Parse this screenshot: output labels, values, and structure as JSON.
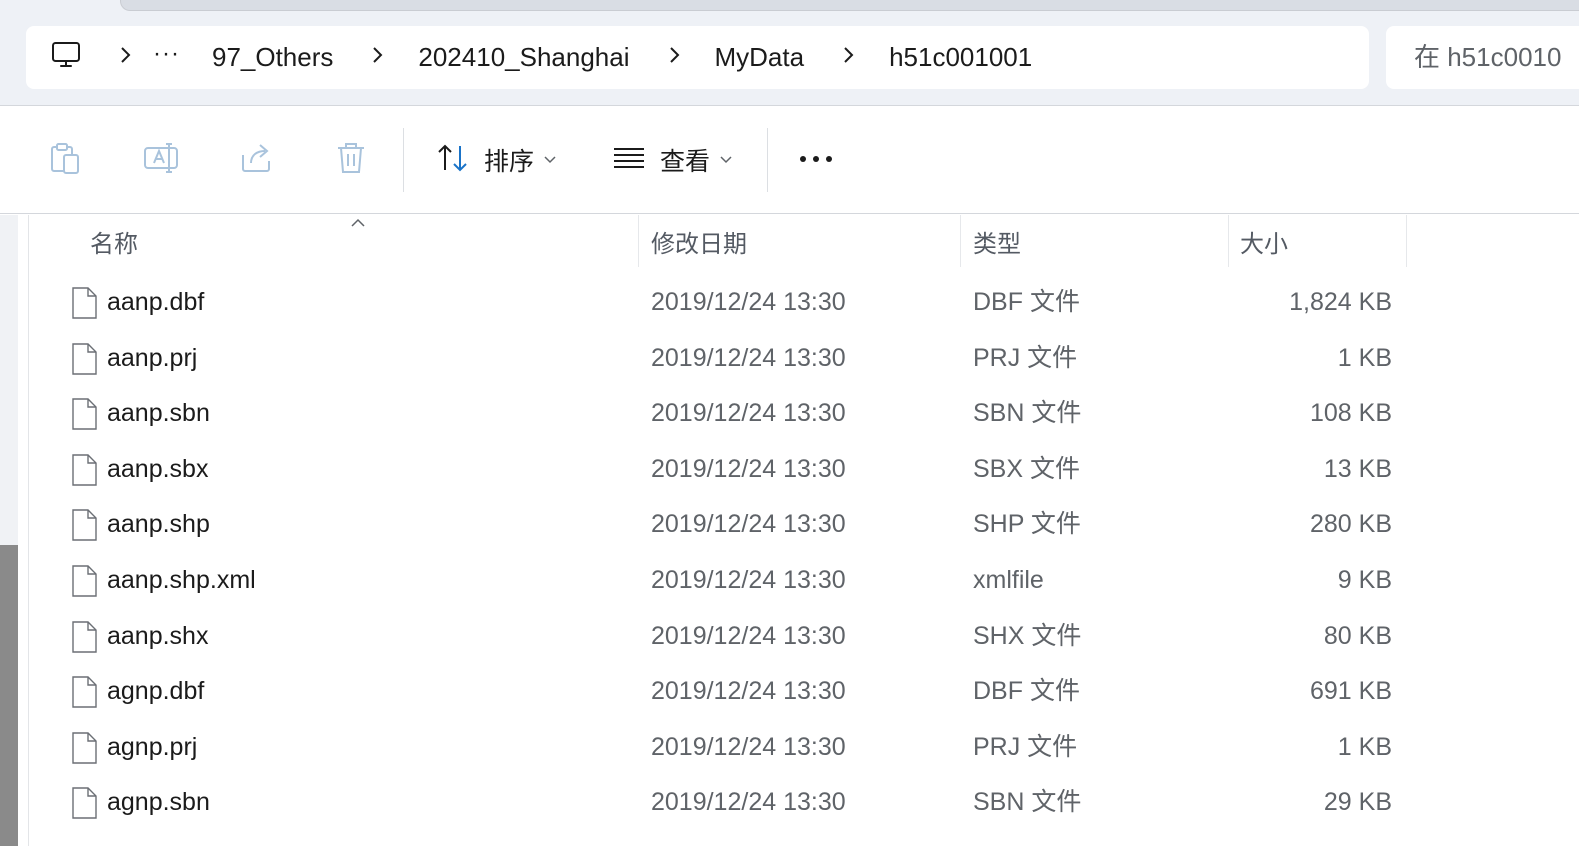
{
  "breadcrumb": {
    "more": "···",
    "items": [
      "97_Others",
      "202410_Shanghai",
      "MyData",
      "h51c001001"
    ]
  },
  "search": {
    "placeholder": "在 h51c0010"
  },
  "toolbar": {
    "sort_label": "排序",
    "view_label": "查看",
    "more_label": "···"
  },
  "columns": {
    "name": "名称",
    "modified": "修改日期",
    "type": "类型",
    "size": "大小"
  },
  "files": [
    {
      "name": "aanp.dbf",
      "modified": "2019/12/24 13:30",
      "type": "DBF 文件",
      "size": "1,824 KB"
    },
    {
      "name": "aanp.prj",
      "modified": "2019/12/24 13:30",
      "type": "PRJ 文件",
      "size": "1 KB"
    },
    {
      "name": "aanp.sbn",
      "modified": "2019/12/24 13:30",
      "type": "SBN 文件",
      "size": "108 KB"
    },
    {
      "name": "aanp.sbx",
      "modified": "2019/12/24 13:30",
      "type": "SBX 文件",
      "size": "13 KB"
    },
    {
      "name": "aanp.shp",
      "modified": "2019/12/24 13:30",
      "type": "SHP 文件",
      "size": "280 KB"
    },
    {
      "name": "aanp.shp.xml",
      "modified": "2019/12/24 13:30",
      "type": "xmlfile",
      "size": "9 KB"
    },
    {
      "name": "aanp.shx",
      "modified": "2019/12/24 13:30",
      "type": "SHX 文件",
      "size": "80 KB"
    },
    {
      "name": "agnp.dbf",
      "modified": "2019/12/24 13:30",
      "type": "DBF 文件",
      "size": "691 KB"
    },
    {
      "name": "agnp.prj",
      "modified": "2019/12/24 13:30",
      "type": "PRJ 文件",
      "size": "1 KB"
    },
    {
      "name": "agnp.sbn",
      "modified": "2019/12/24 13:30",
      "type": "SBN 文件",
      "size": "29 KB"
    }
  ]
}
